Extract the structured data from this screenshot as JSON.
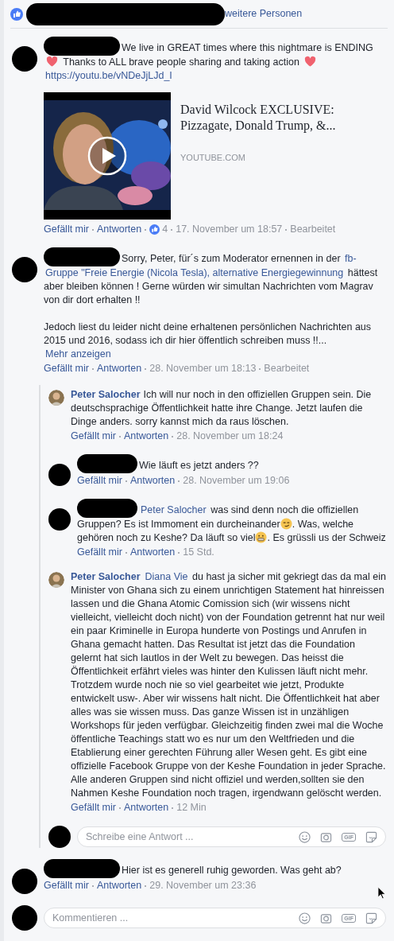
{
  "likes_bar": {
    "text": "weitere Personen"
  },
  "comments": [
    {
      "redacted": true,
      "paragraphs": [
        [
          {
            "kind": "text",
            "text": "We live in GREAT times where this nightmare is ENDING "
          },
          {
            "kind": "heart"
          },
          {
            "kind": "text",
            "text": " Thanks to ALL brave people sharing and taking action "
          },
          {
            "kind": "heart"
          },
          {
            "kind": "link",
            "text": "https://youtu.be/vNDeJjLJd_I"
          }
        ]
      ],
      "preview": {
        "title": "David Wilcock EXCLUSIVE: Pizzagate, Donald Trump, &...",
        "domain": "YOUTUBE.COM"
      },
      "meta": {
        "actions": [
          "Gefällt mir",
          "Antworten"
        ],
        "reaction_count": "4",
        "time": "17. November um 18:57",
        "edited": "Bearbeitet"
      }
    },
    {
      "redacted": true,
      "paragraphs": [
        [
          {
            "kind": "text",
            "text": "Sorry, Peter, für´s zum Moderator ernennen in der "
          },
          {
            "kind": "link",
            "text": "fb-"
          },
          {
            "kind": "link",
            "text": "Gruppe \"Freie Energie (Nicola Tesla), alternative Energiegewinnung"
          },
          {
            "kind": "text",
            "text": " hättest aber bleiben können ! Gerne würden wir simultan Nachrichten vom Magrav von dir dort erhalten !!"
          }
        ],
        [
          {
            "kind": "text",
            "text": "Jedoch liest du leider nicht deine erhaltenen persönlichen Nachrichten aus 2015 und 2016, sodass ich dir hier öffentlich schreiben muss !!... "
          },
          {
            "kind": "link",
            "text": "Mehr anzeigen"
          }
        ]
      ],
      "meta": {
        "actions": [
          "Gefällt mir",
          "Antworten"
        ],
        "time": "28. November um 18:13",
        "edited": "Bearbeitet"
      },
      "replies": [
        {
          "redacted": false,
          "author": "Peter Salocher",
          "paragraphs": [
            [
              {
                "kind": "text",
                "text": "Ich will nur noch in den offiziellen Gruppen sein. Die deutschsprachige Öffentlichkeit hatte ihre Change. Jetzt laufen die Dinge anders. sorry kannst mich da raus löschen."
              }
            ]
          ],
          "meta": {
            "actions": [
              "Gefällt mir",
              "Antworten"
            ],
            "time": "28. November um 18:24"
          }
        },
        {
          "redacted": true,
          "paragraphs": [
            [
              {
                "kind": "text",
                "text": "Wie läuft es jetzt anders ??"
              }
            ]
          ],
          "meta": {
            "actions": [
              "Gefällt mir",
              "Antworten"
            ],
            "time": "28. November um 19:06"
          }
        },
        {
          "redacted": true,
          "paragraphs": [
            [
              {
                "kind": "link",
                "text": "Peter Salocher"
              },
              {
                "kind": "text",
                "text": " was sind denn noch die offiziellen Gruppen? Es ist Immoment ein durcheinander"
              },
              {
                "kind": "smirk"
              },
              {
                "kind": "text",
                "text": ". Was, welche gehören noch zu Keshe? Da läuft so viel"
              },
              {
                "kind": "grimace"
              },
              {
                "kind": "text",
                "text": ". Es grüssli us der Schweiz"
              }
            ]
          ],
          "meta": {
            "actions": [
              "Gefällt mir",
              "Antworten"
            ],
            "time": "15 Std."
          }
        },
        {
          "redacted": false,
          "author": "Peter Salocher",
          "paragraphs": [
            [
              {
                "kind": "link",
                "text": "Diana Vie"
              },
              {
                "kind": "text",
                "text": " du hast ja sicher mit gekriegt das da mal ein Minister von Ghana sich zu einem unrichtigen Statement hat hinreissen lassen und die Ghana Atomic Comission sich (wir wissens nicht vielleicht, vielleicht doch nicht) von der Foundation getrennt hat nur weil ein paar Kriminelle in Europa hunderte von Postings und Anrufen in Ghana gemacht hatten. Das Resultat ist jetzt das die Foundation gelernt hat sich lautlos in der Welt zu bewegen. Das heisst die Öffentlichkeit erfährt vieles was hinter den Kulissen läuft nicht mehr. Trotzdem wurde noch nie so viel gearbeitet wie jetzt, Produkte entwickelt usw-. Aber wir wissens halt nicht. Die Öffentlichkeit hat aber alles was sie wissen muss. Das ganze Wissen ist in unzähligen Workshops für jeden verfügbar. Gleichzeitig finden zwei mal die Woche öffentliche Teachings statt wo es nur um den Weltfrieden und die Etablierung einer gerechten Führung aller Wesen geht. Es gibt eine offizielle Facebook Gruppe von der Keshe Foundation in jeder Sprache. Alle anderen Gruppen sind nicht offiziel und werden,sollten sie den Nahmen Keshe Foundation noch tragen, irgendwann gelöscht werden."
              }
            ]
          ],
          "meta": {
            "actions": [
              "Gefällt mir",
              "Antworten"
            ],
            "time": "12 Min"
          }
        }
      ],
      "reply_composer": {
        "placeholder": "Schreibe eine Antwort ...",
        "gif_label": "GIF"
      }
    },
    {
      "redacted": true,
      "paragraphs": [
        [
          {
            "kind": "text",
            "text": "Hier ist es generell ruhig geworden. Was geht ab?"
          }
        ]
      ],
      "meta": {
        "actions": [
          "Gefällt mir",
          "Antworten"
        ],
        "time": "29. November um 23:36"
      }
    }
  ],
  "composer": {
    "placeholder": "Kommentieren ...",
    "gif_label": "GIF"
  }
}
